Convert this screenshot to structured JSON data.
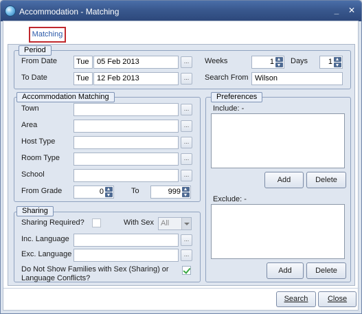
{
  "window": {
    "title": "Accommodation - Matching",
    "min_glyph": "_",
    "close_glyph": "✕"
  },
  "tab": {
    "label": "Matching"
  },
  "period": {
    "legend": "Period",
    "from_date_label": "From Date",
    "from_dow": "Tue",
    "from_date": "05 Feb 2013",
    "to_date_label": "To Date",
    "to_dow": "Tue",
    "to_date": "12 Feb 2013",
    "weeks_label": "Weeks",
    "weeks_value": "1",
    "days_label": "Days",
    "days_value": "1",
    "search_from_label": "Search From",
    "search_from_value": "Wilson"
  },
  "accommodation": {
    "legend": "Accommodation Matching",
    "town_label": "Town",
    "area_label": "Area",
    "host_type_label": "Host Type",
    "room_type_label": "Room Type",
    "school_label": "School",
    "from_grade_label": "From Grade",
    "from_grade_value": "0",
    "to_label": "To",
    "to_grade_value": "999"
  },
  "preferences": {
    "legend": "Preferences",
    "include_label": "Include: -",
    "include_add": "Add",
    "include_delete": "Delete",
    "exclude_label": "Exclude: -",
    "exclude_add": "Add",
    "exclude_delete": "Delete"
  },
  "sharing": {
    "legend": "Sharing",
    "sharing_required_label": "Sharing Required?",
    "sharing_required_checked": false,
    "with_sex_label": "With Sex",
    "with_sex_value": "All",
    "inc_language_label": "Inc. Language",
    "exc_language_label": "Exc. Language",
    "conflict_label_line1": "Do Not Show Families with Sex (Sharing) or",
    "conflict_label_line2": "Language Conflicts?",
    "conflict_checked": true
  },
  "footer": {
    "search_label": "Search",
    "close_label": "Close"
  },
  "ellipsis_glyph": "..."
}
